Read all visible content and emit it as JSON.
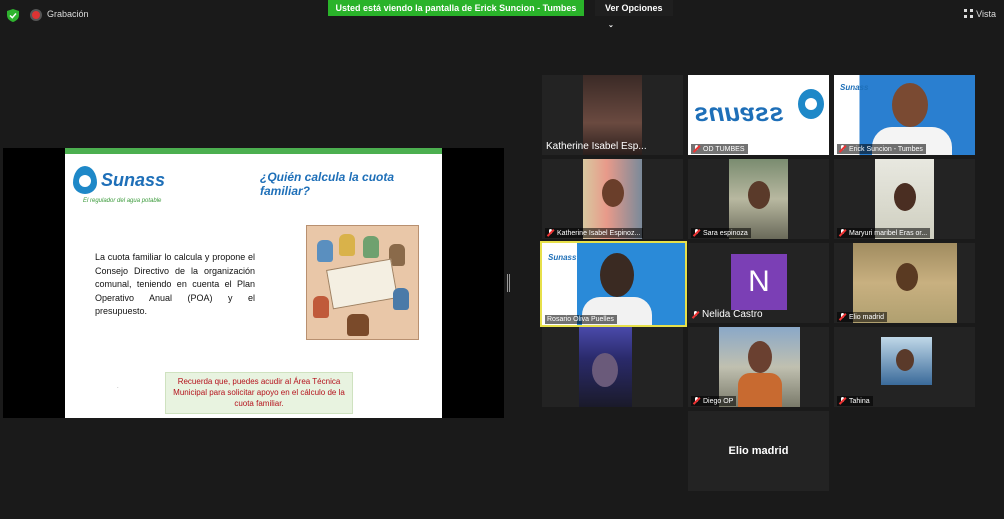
{
  "topbar": {
    "recording_label": "Grabación",
    "share_banner": "Usted está viendo la pantalla de Erick Suncion - Tumbes",
    "view_options": "Ver Opciones",
    "view_label": "Vista"
  },
  "slide": {
    "logo_word": "Sunass",
    "logo_tagline": "El regulador del agua potable",
    "title": "¿Quién calcula la cuota familiar?",
    "body": "La cuota familiar lo calcula y propone el Consejo Directivo de la organización comunal, teniendo en cuenta el Plan Operativo Anual (POA) y el presupuesto.",
    "note": "Recuerda que, puedes acudir al Área Técnica Municipal para solicitar apoyo en el cálculo de la cuota familiar.",
    "dot": "."
  },
  "participants": [
    {
      "name": "Katherine Isabel Esp...",
      "muted": false
    },
    {
      "name": "OD TUMBES",
      "muted": true
    },
    {
      "name": "Erick Suncion - Tumbes",
      "muted": true
    },
    {
      "name": "Katherine Isabel Espinoz...",
      "muted": true
    },
    {
      "name": "Sara espinoza",
      "muted": true
    },
    {
      "name": "Maryuri maribel Eras or...",
      "muted": true
    },
    {
      "name": "Rosario Oliva Puelles",
      "muted": false
    },
    {
      "name": "Nelida Castro",
      "muted": true
    },
    {
      "name": "Elio madrid",
      "muted": true
    },
    {
      "name": "",
      "muted": false
    },
    {
      "name": "Diego OP",
      "muted": true
    },
    {
      "name": "Tahina",
      "muted": true
    },
    {
      "name": "Elio madrid",
      "muted": false
    }
  ],
  "avatar_initial": "N",
  "colors": {
    "banner": "#2ab32a",
    "slide_accent": "#4caf50",
    "brand_blue": "#1e6fb8",
    "note_text": "#b4121c",
    "active_speaker": "#e7e04a",
    "avatar_bg": "#7b3fb5"
  }
}
